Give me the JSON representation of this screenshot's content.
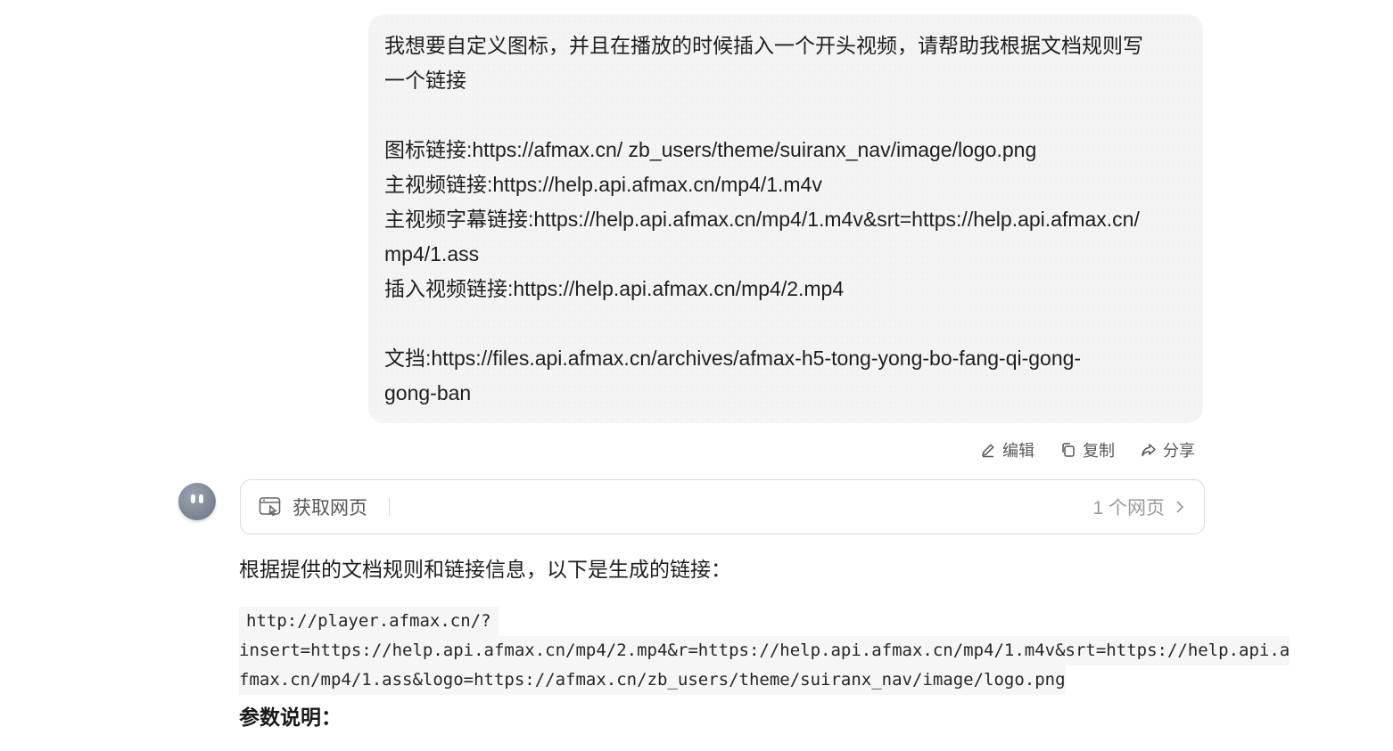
{
  "user_message": {
    "lines": [
      "我想要自定义图标，并且在播放的时候插入一个开头视频，请帮助我根据文档规则写",
      "一个链接",
      "",
      "图标链接:https://afmax.cn/  zb_users/theme/suiranx_nav/image/logo.png",
      "主视频链接:https://help.api.afmax.cn/mp4/1.m4v",
      "主视频字幕链接:https://help.api.afmax.cn/mp4/1.m4v&srt=https://help.api.afmax.cn/",
      "mp4/1.ass",
      "插入视频链接:https://help.api.afmax.cn/mp4/2.mp4",
      "",
      "文挡:https://files.api.afmax.cn/archives/afmax-h5-tong-yong-bo-fang-qi-gong-",
      "gong-ban"
    ]
  },
  "actions": {
    "edit": "编辑",
    "copy": "复制",
    "share": "分享"
  },
  "tool_card": {
    "label": "获取网页",
    "count": "1 个网页"
  },
  "answer": {
    "intro": "根据提供的文档规则和链接信息，以下是生成的链接：",
    "code_lines": [
      "http://player.afmax.cn/?",
      "insert=https://help.api.afmax.cn/mp4/2.mp4&r=https://help.api.afmax.cn/mp4/1.m4v&srt=https://help.api.a",
      "fmax.cn/mp4/1.ass&logo=https://afmax.cn/zb_users/theme/suiranx_nav/image/logo.png"
    ],
    "param_title": "参数说明："
  }
}
